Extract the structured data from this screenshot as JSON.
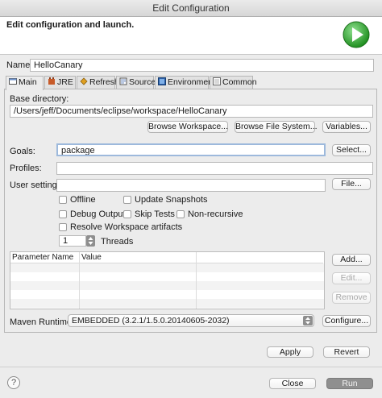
{
  "window": {
    "title": "Edit Configuration"
  },
  "header": {
    "title": "Edit configuration and launch."
  },
  "name": {
    "label": "Name:",
    "value": "HelloCanary"
  },
  "tabs": [
    {
      "label": "Main"
    },
    {
      "label": "JRE"
    },
    {
      "label": "Refresh"
    },
    {
      "label": "Source"
    },
    {
      "label": "Environment"
    },
    {
      "label": "Common"
    }
  ],
  "main": {
    "base_directory_label": "Base directory:",
    "base_directory_value": "/Users/jeff/Documents/eclipse/workspace/HelloCanary",
    "browse_workspace": "Browse Workspace...",
    "browse_file_system": "Browse File System...",
    "variables": "Variables...",
    "goals_label": "Goals:",
    "goals_value": "package",
    "select": "Select...",
    "profiles_label": "Profiles:",
    "profiles_value": "",
    "user_settings_label": "User settings:",
    "user_settings_value": "",
    "file": "File...",
    "offline": "Offline",
    "update_snapshots": "Update Snapshots",
    "debug_output": "Debug Output",
    "skip_tests": "Skip Tests",
    "non_recursive": "Non-recursive",
    "resolve_workspace": "Resolve Workspace artifacts",
    "threads_value": "1",
    "threads_label": "Threads",
    "param_col_name": "Parameter Name",
    "param_col_value": "Value",
    "add": "Add...",
    "edit": "Edit...",
    "remove": "Remove",
    "maven_runtime_label": "Maven Runtime:",
    "maven_runtime_value": "EMBEDDED (3.2.1/1.5.0.20140605-2032)",
    "configure": "Configure..."
  },
  "footer": {
    "apply": "Apply",
    "revert": "Revert",
    "help": "?",
    "close": "Close",
    "run": "Run"
  },
  "colors": {
    "run_green": "#3cae3c",
    "disabled_run": "#8f8f8f"
  }
}
